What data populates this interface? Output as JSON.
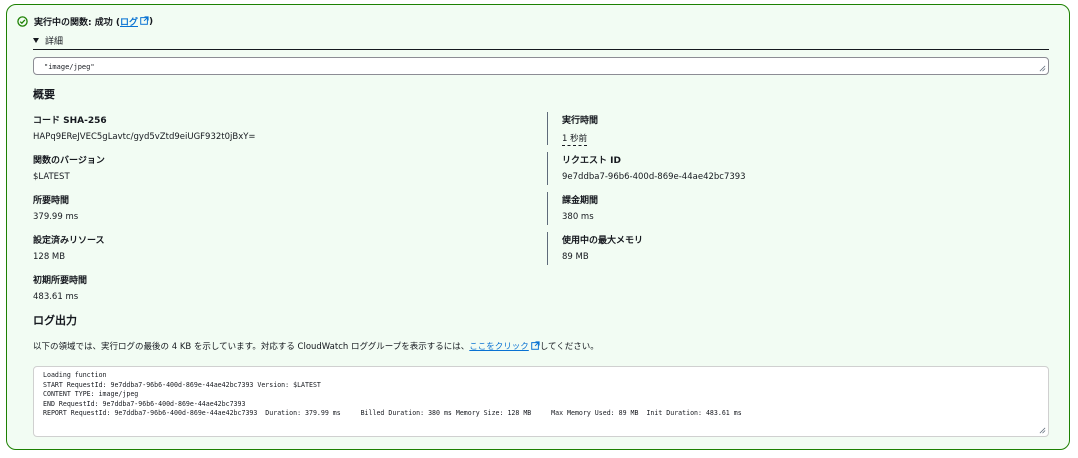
{
  "header": {
    "status_text": "実行中の関数: 成功 (",
    "log_link": "ログ",
    "close_paren": ")",
    "details_label": "詳細"
  },
  "payload": {
    "value": "\"image/jpeg\""
  },
  "summary": {
    "title": "概要",
    "fields": [
      {
        "label": "コード SHA-256",
        "value": "HAPq9EReJVEC5gLavtc/gyd5vZtd9eiUGF932t0jBxY="
      },
      {
        "label": "実行時間",
        "value": "1 秒前"
      },
      {
        "label": "関数のバージョン",
        "value": "$LATEST"
      },
      {
        "label": "リクエスト ID",
        "value": "9e7ddba7-96b6-400d-869e-44ae42bc7393"
      },
      {
        "label": "所要時間",
        "value": "379.99 ms"
      },
      {
        "label": "課金期間",
        "value": "380 ms"
      },
      {
        "label": "設定済みリソース",
        "value": "128 MB"
      },
      {
        "label": "使用中の最大メモリ",
        "value": "89 MB"
      },
      {
        "label": "初期所要時間",
        "value": "483.61 ms"
      }
    ]
  },
  "log_output": {
    "title": "ログ出力",
    "description_before": "以下の領域では、実行ログの最後の 4 KB を示しています。対応する CloudWatch ロググループを表示するには、",
    "link_text": "ここをクリック",
    "description_after": "してください。",
    "lines": [
      "Loading function",
      "START RequestId: 9e7ddba7-96b6-400d-869e-44ae42bc7393 Version: $LATEST",
      "CONTENT TYPE: image/jpeg",
      "END RequestId: 9e7ddba7-96b6-400d-869e-44ae42bc7393",
      "REPORT RequestId: 9e7ddba7-96b6-400d-869e-44ae42bc7393  Duration: 379.99 ms     Billed Duration: 380 ms Memory Size: 128 MB     Max Memory Used: 89 MB  Init Duration: 483.61 ms"
    ]
  },
  "colors": {
    "success_green": "#1d8102",
    "panel_bg": "#f2fcf3",
    "link_blue": "#0972d3"
  }
}
